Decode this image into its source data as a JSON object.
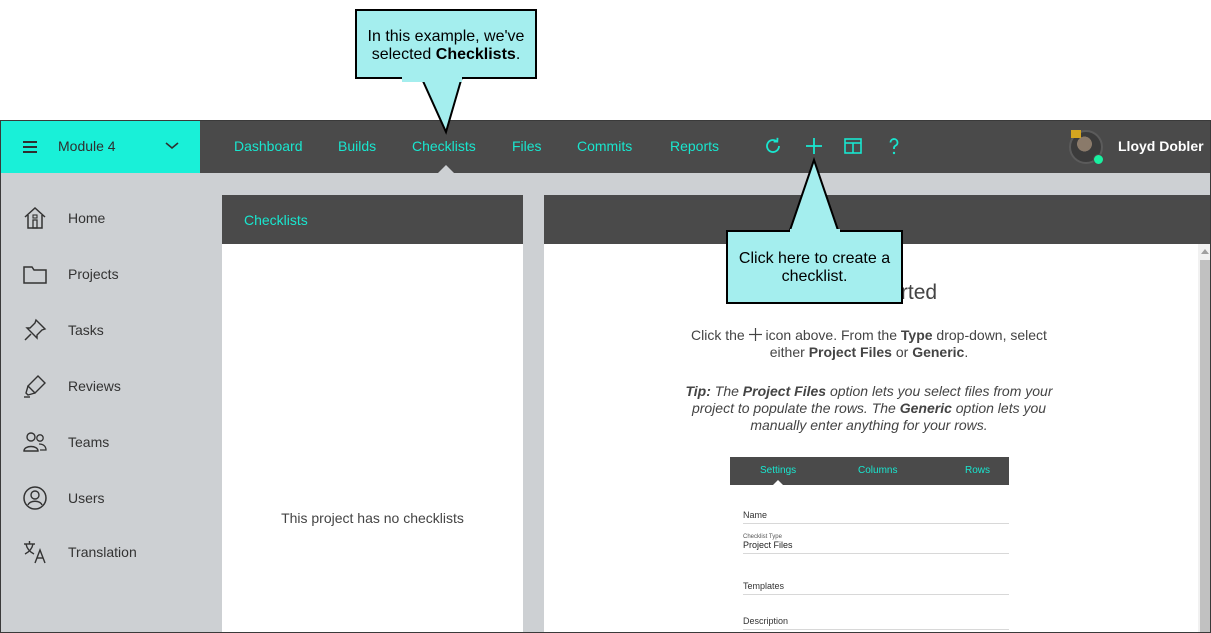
{
  "topbar": {
    "module_name": "Module 4",
    "nav": [
      "Dashboard",
      "Builds",
      "Checklists",
      "Files",
      "Commits",
      "Reports"
    ],
    "active_nav": "Checklists",
    "icons": [
      "refresh-icon",
      "plus-icon",
      "layout-icon",
      "help-icon"
    ],
    "user_name": "Lloyd Dobler"
  },
  "sidebar": {
    "items": [
      {
        "label": "Home",
        "icon": "home-icon"
      },
      {
        "label": "Projects",
        "icon": "folder-icon"
      },
      {
        "label": "Tasks",
        "icon": "pin-icon"
      },
      {
        "label": "Reviews",
        "icon": "highlighter-icon"
      },
      {
        "label": "Teams",
        "icon": "people-icon"
      },
      {
        "label": "Users",
        "icon": "user-circle-icon"
      },
      {
        "label": "Translation",
        "icon": "translate-icon"
      }
    ]
  },
  "list_panel": {
    "title": "Checklists",
    "empty_text": "This project has no checklists"
  },
  "main_panel": {
    "title_partial": "rted",
    "para1_a": "Click the ",
    "para1_b": " icon above. From the ",
    "para1_type": "Type",
    "para1_c": " drop-down, select either ",
    "para1_pf": "Project Files",
    "para1_or": " or ",
    "para1_generic": "Generic",
    "para1_end": ".",
    "tip_label": "Tip:",
    "tip_a": " The ",
    "tip_pf": "Project Files",
    "tip_b": " option lets you select files from your project to populate the rows. The ",
    "tip_generic": "Generic",
    "tip_c": " option lets you manually enter anything for your rows.",
    "mini": {
      "tabs": [
        "Settings",
        "Columns",
        "Rows"
      ],
      "name_label": "Name",
      "type_label": "Checklist Type",
      "type_value": "Project Files",
      "templates_label": "Templates",
      "description_label": "Description"
    }
  },
  "callouts": {
    "top_a": "In this example, we've selected ",
    "top_bold": "Checklists",
    "top_end": ".",
    "middle": "Click here to create a checklist."
  },
  "colors": {
    "accent": "#19f0d8",
    "nav_text": "#19e6cf",
    "bar": "#4a4a4a",
    "sidebar": "#cdd0d3",
    "callout": "#a4eeee"
  }
}
